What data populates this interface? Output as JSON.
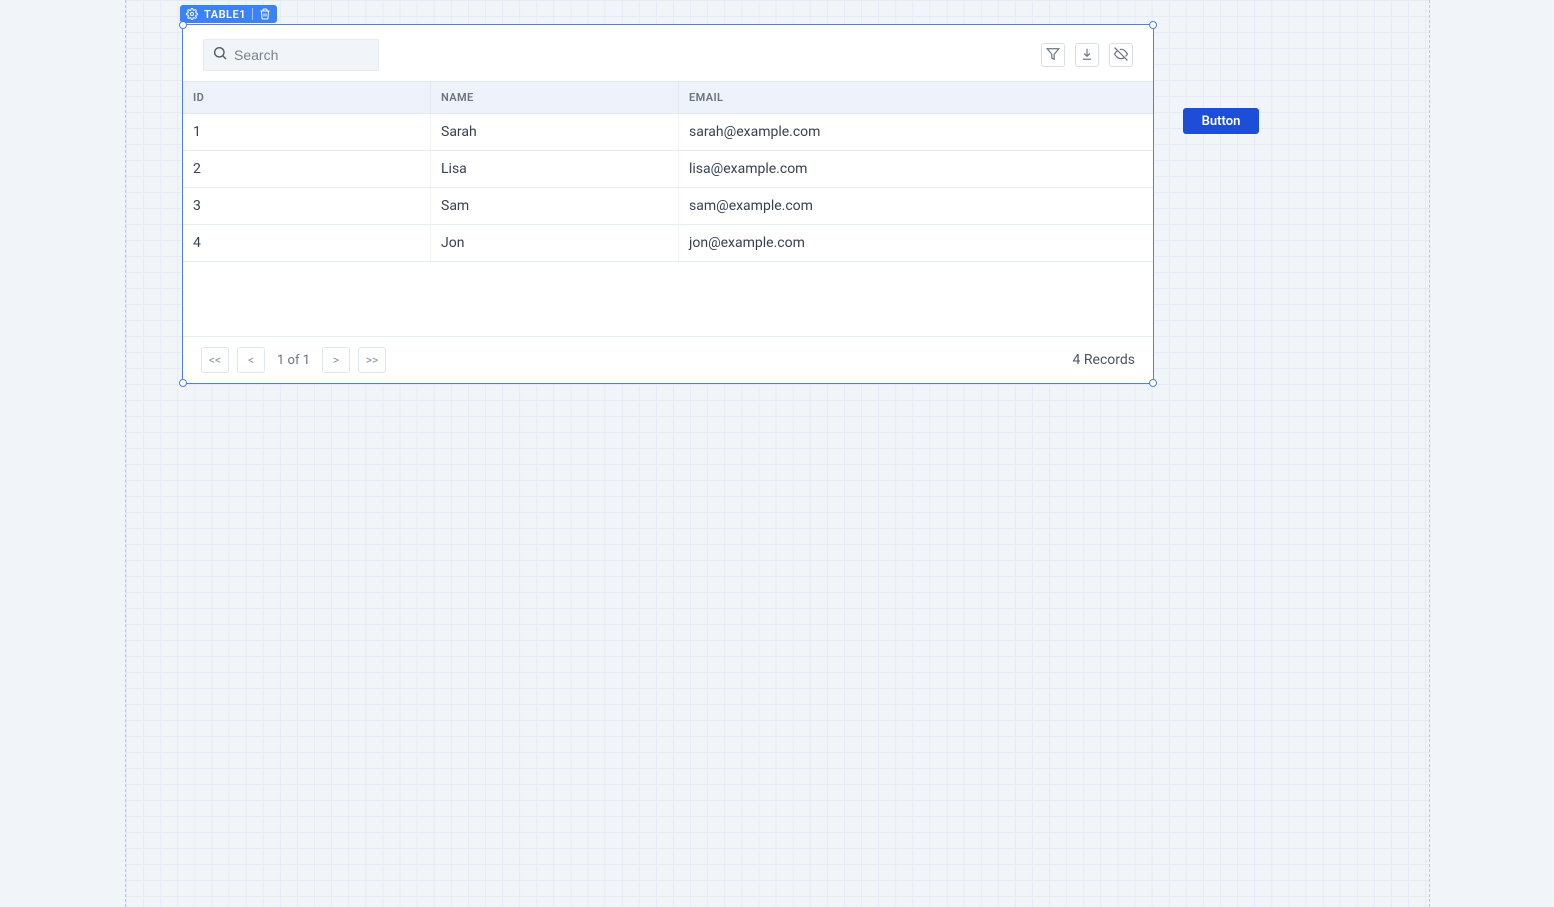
{
  "widget": {
    "name": "TABLE1"
  },
  "toolbar": {
    "search_placeholder": "Search"
  },
  "table": {
    "columns": [
      "ID",
      "NAME",
      "EMAIL"
    ],
    "rows": [
      {
        "id": "1",
        "name": "Sarah",
        "email": "sarah@example.com"
      },
      {
        "id": "2",
        "name": "Lisa",
        "email": "lisa@example.com"
      },
      {
        "id": "3",
        "name": "Sam",
        "email": "sam@example.com"
      },
      {
        "id": "4",
        "name": "Jon",
        "email": "jon@example.com"
      }
    ]
  },
  "pagination": {
    "first": "<<",
    "prev": "<",
    "info": "1 of 1",
    "next": ">",
    "last": ">>"
  },
  "footer": {
    "records": "4 Records"
  },
  "button": {
    "label": "Button"
  }
}
